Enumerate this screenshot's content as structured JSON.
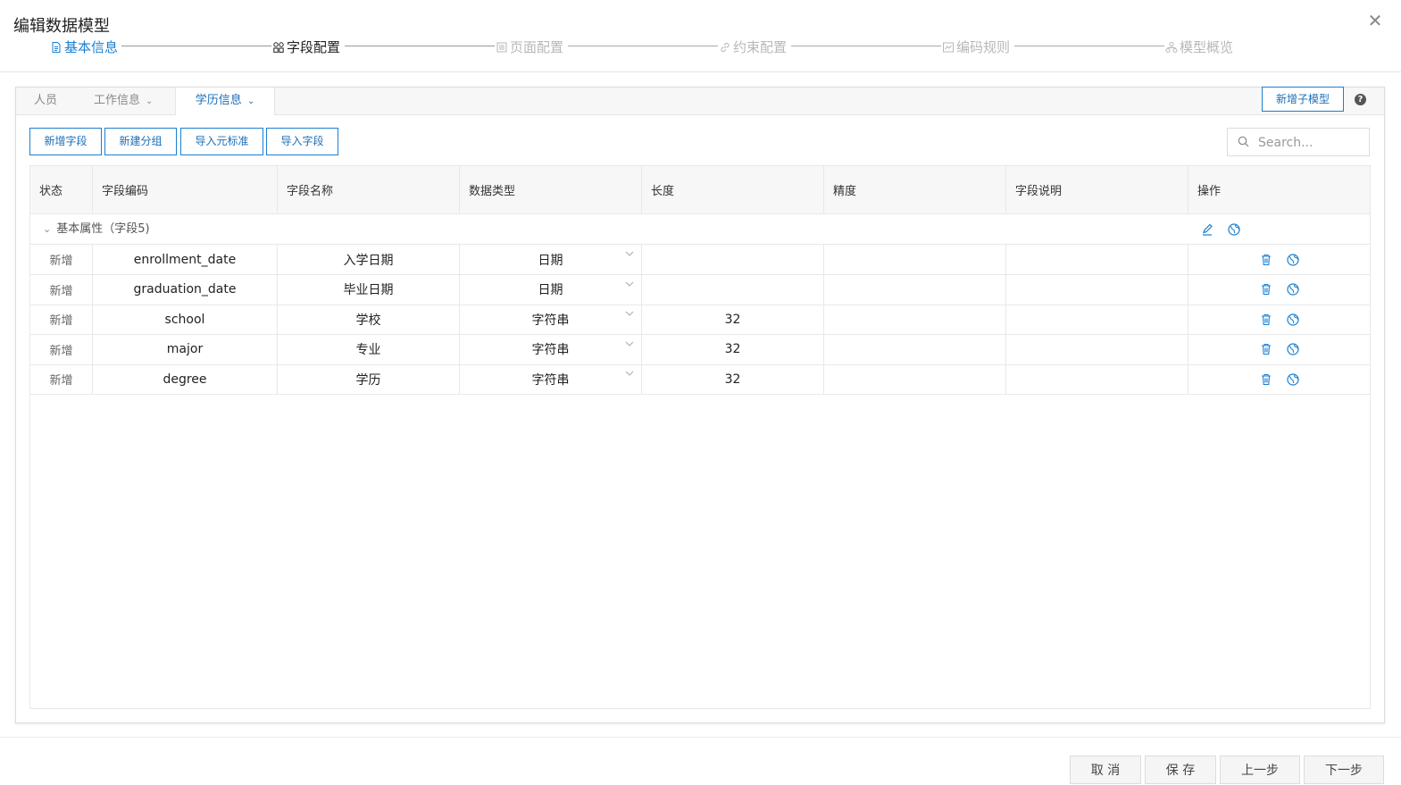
{
  "dialog": {
    "title": "编辑数据模型"
  },
  "steps": [
    {
      "label": "基本信息",
      "state": "done",
      "icon": "document-icon"
    },
    {
      "label": "字段配置",
      "state": "active",
      "icon": "grid-icon"
    },
    {
      "label": "页面配置",
      "state": "todo",
      "icon": "page-icon"
    },
    {
      "label": "约束配置",
      "state": "todo",
      "icon": "link-icon"
    },
    {
      "label": "编码规则",
      "state": "todo",
      "icon": "code-icon"
    },
    {
      "label": "模型概览",
      "state": "todo",
      "icon": "hierarchy-icon"
    }
  ],
  "tabs": [
    {
      "label": "人员"
    },
    {
      "label": "工作信息"
    },
    {
      "label": "学历信息",
      "active": true
    }
  ],
  "panel": {
    "add_submodel_label": "新增子模型",
    "help_label": "?"
  },
  "toolbar": {
    "add_field": "新增字段",
    "add_group": "新建分组",
    "import_meta": "导入元标准",
    "import_field": "导入字段"
  },
  "search": {
    "placeholder": "Search...",
    "value": ""
  },
  "table": {
    "columns": [
      "状态",
      "字段编码",
      "字段名称",
      "数据类型",
      "长度",
      "精度",
      "字段说明",
      "操作"
    ],
    "group": {
      "label": "基本属性（字段5)"
    },
    "rows": [
      {
        "status": "新增",
        "code": "enrollment_date",
        "name": "入学日期",
        "type": "日期",
        "length": "",
        "precision": "",
        "desc": ""
      },
      {
        "status": "新增",
        "code": "graduation_date",
        "name": "毕业日期",
        "type": "日期",
        "length": "",
        "precision": "",
        "desc": ""
      },
      {
        "status": "新增",
        "code": "school",
        "name": "学校",
        "type": "字符串",
        "length": "32",
        "precision": "",
        "desc": ""
      },
      {
        "status": "新增",
        "code": "major",
        "name": "专业",
        "type": "字符串",
        "length": "32",
        "precision": "",
        "desc": ""
      },
      {
        "status": "新增",
        "code": "degree",
        "name": "学历",
        "type": "字符串",
        "length": "32",
        "precision": "",
        "desc": ""
      }
    ]
  },
  "footer": {
    "cancel": "取 消",
    "save": "保 存",
    "prev": "上一步",
    "next": "下一步"
  },
  "colors": {
    "accent": "#1b7fd0",
    "active_step": "#222222",
    "todo_step": "#b8b8b8"
  }
}
